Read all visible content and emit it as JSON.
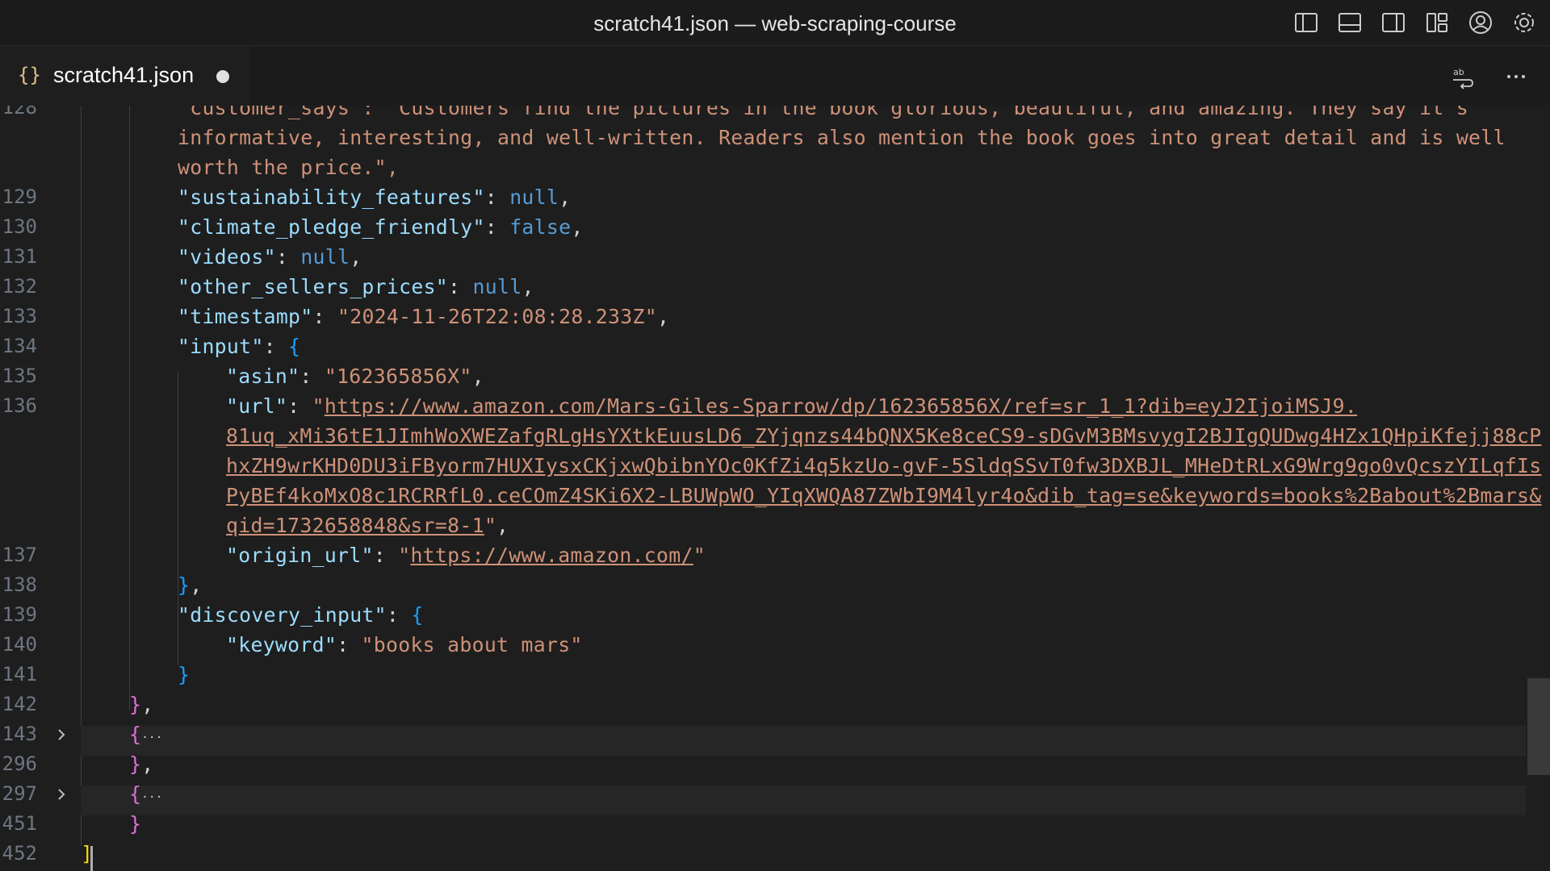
{
  "window": {
    "title": "scratch41.json — web-scraping-course"
  },
  "titlebar_icons": [
    "toggle-primary-sidebar-icon",
    "toggle-panel-icon",
    "toggle-secondary-sidebar-icon",
    "customize-layout-icon",
    "accounts-icon",
    "settings-gear-icon"
  ],
  "tab": {
    "icon": "{}",
    "label": "scratch41.json",
    "modified": true
  },
  "tab_actions": [
    "word-wrap-icon",
    "more-actions-icon"
  ],
  "editor": {
    "line_numbers": [
      "128",
      "129",
      "130",
      "131",
      "132",
      "133",
      "134",
      "135",
      "136",
      "137",
      "138",
      "139",
      "140",
      "141",
      "142",
      "143",
      "296",
      "297",
      "451",
      "452"
    ],
    "l128a": "\"customer_says\": \"Customers find the pictures in the book glorious, beautiful, and amazing. They say it's",
    "l128b": "informative, interesting, and well-written. Readers also mention the book goes into great detail and is well",
    "l128c": "worth the price.\",",
    "k129": "\"sustainability_features\"",
    "v129": "null",
    "k130": "\"climate_pledge_friendly\"",
    "v130": "false",
    "k131": "\"videos\"",
    "v131": "null",
    "k132": "\"other_sellers_prices\"",
    "v132": "null",
    "k133": "\"timestamp\"",
    "v133": "\"2024-11-26T22:08:28.233Z\"",
    "k134": "\"input\"",
    "k135": "\"asin\"",
    "v135": "\"162365856X\"",
    "k136": "\"url\"",
    "url_l1": "https://www.amazon.com/Mars-Giles-Sparrow/dp/162365856X/ref=sr_1_1?dib=eyJ2IjoiMSJ9.",
    "url_l2": "81uq_xMi36tE1JImhWoXWEZafgRLgHsYXtkEuusLD6_ZYjqnzs44bQNX5Ke8ceCS9-sDGvM3BMsvygI2BJIgQUDwg4HZx1QHpiKfejj88cP",
    "url_l3": "hxZH9wrKHD0DU3iFByorm7HUXIysxCKjxwQbibnYOc0KfZi4q5kzUo-gvF-5SldqSSvT0fw3DXBJL_MHeDtRLxG9Wrg9go0vQcszYILqfIs",
    "url_l4": "PyBEf4koMxO8c1RCRRfL0.ceCOmZ4SKi6X2-LBUWpWO_YIqXWQA87ZWbI9M4lyr4o&dib_tag=se&keywords=books%2Babout%2Bmars&",
    "url_l5": "qid=1732658848&sr=8-1",
    "k137": "\"origin_url\"",
    "v137": "https://www.amazon.com/",
    "k139": "\"discovery_input\"",
    "k140": "\"keyword\"",
    "v140": "\"books about mars\"",
    "ellipsis": "···"
  }
}
